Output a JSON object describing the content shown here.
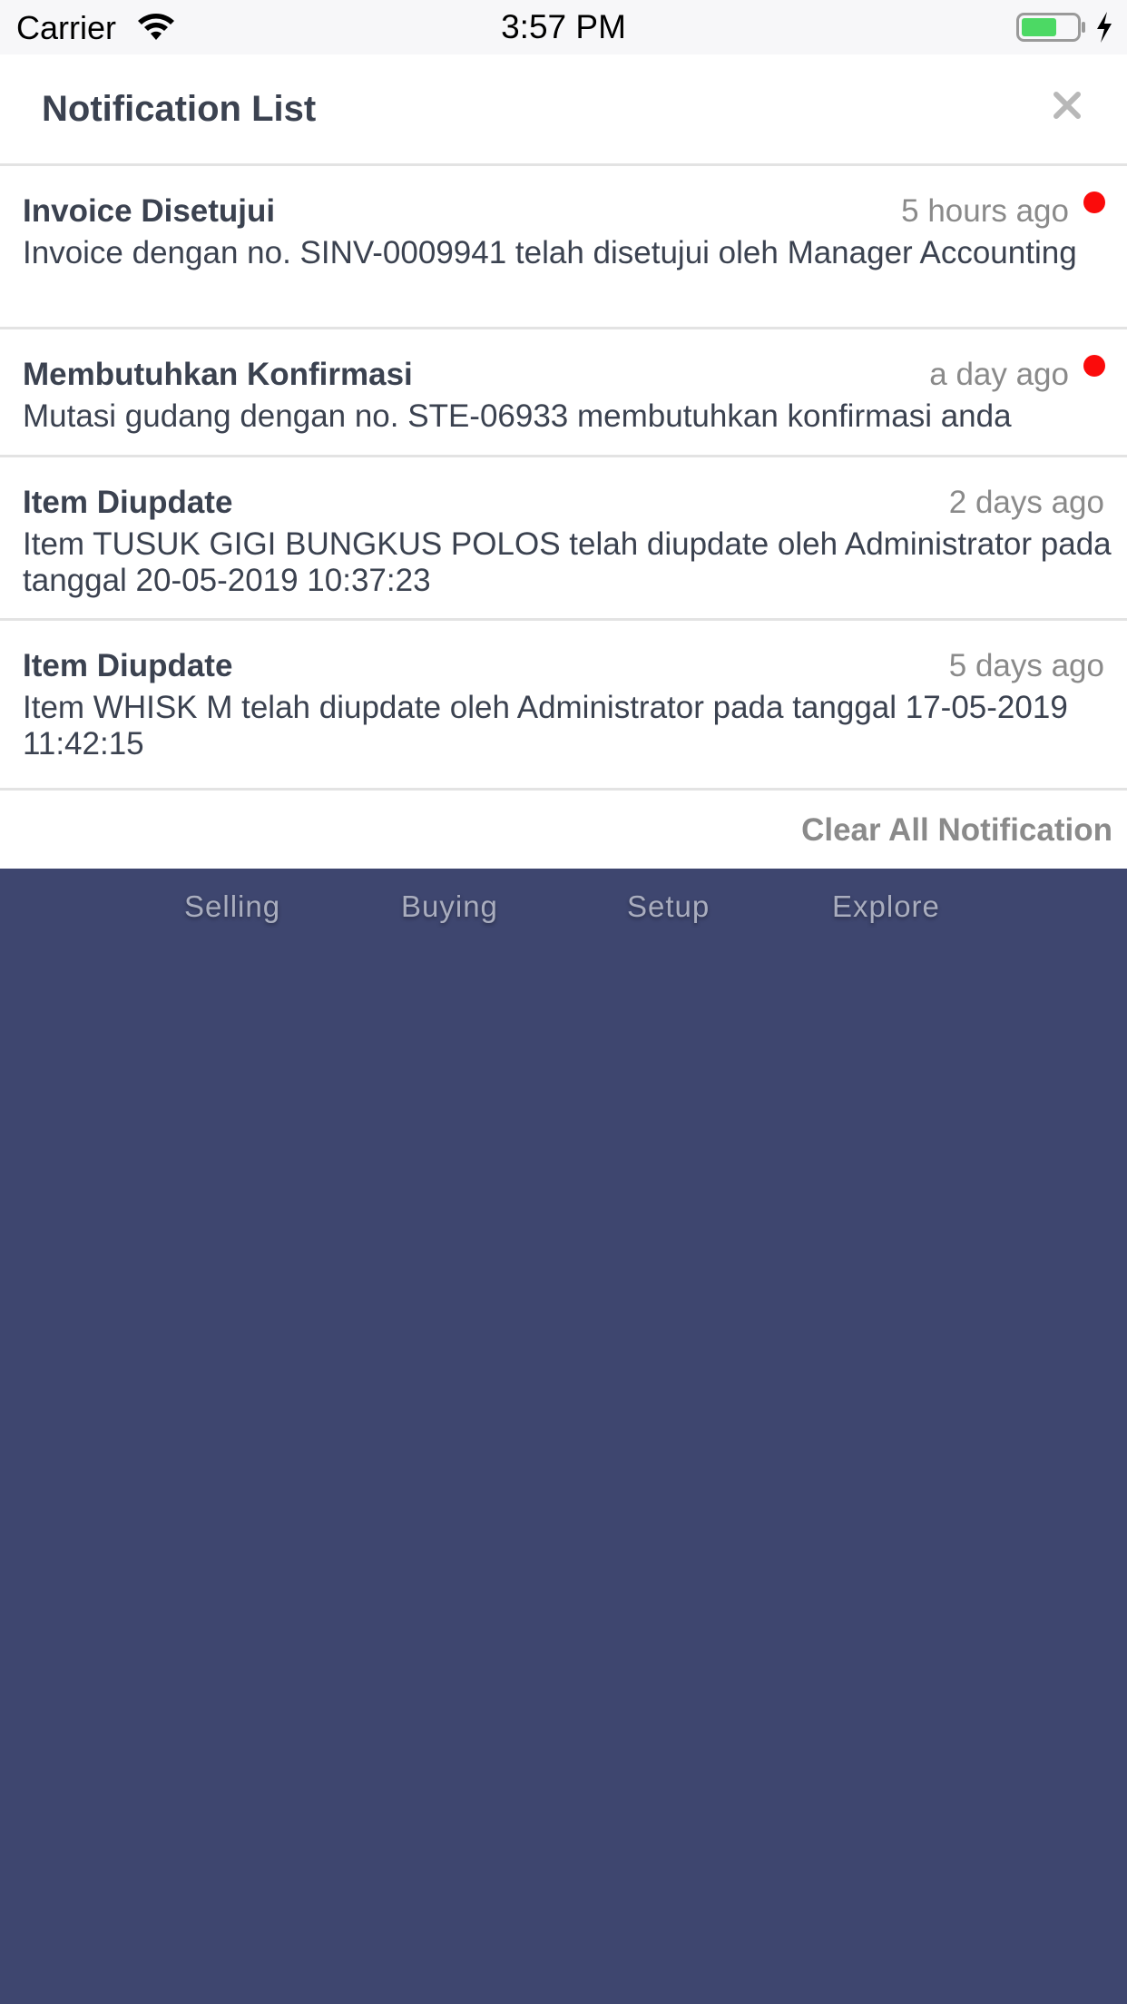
{
  "status_bar": {
    "carrier": "Carrier",
    "time": "3:57 PM",
    "battery_color": "#4cd964"
  },
  "panel": {
    "title": "Notification List",
    "close_icon": "close-icon",
    "notifications": [
      {
        "title": "Invoice Disetujui",
        "time": "5 hours ago",
        "body": "Invoice dengan no. SINV-0009941 telah disetujui oleh Manager Accounting",
        "unread": true
      },
      {
        "title": "Membutuhkan Konfirmasi",
        "time": "a day ago",
        "body": "Mutasi gudang dengan no. STE-06933 membutuhkan konfirmasi anda",
        "unread": true
      },
      {
        "title": "Item Diupdate",
        "time": "2 days ago",
        "body": "Item TUSUK GIGI BUNGKUS POLOS telah diupdate oleh Administrator pada tanggal 20-05-2019 10:37:23",
        "unread": false
      },
      {
        "title": "Item Diupdate",
        "time": "5 days ago",
        "body": "Item WHISK M telah diupdate oleh Administrator pada tanggal 17-05-2019 11:42:15",
        "unread": false
      }
    ],
    "clear_label": "Clear All Notification",
    "unread_color": "#fb0b0b"
  },
  "background_tabs": {
    "items": [
      "Selling",
      "Buying",
      "Setup",
      "Explore"
    ]
  },
  "colors": {
    "background": "#3e466f",
    "title_text": "#3b4250",
    "muted_text": "#8a8a8a"
  }
}
